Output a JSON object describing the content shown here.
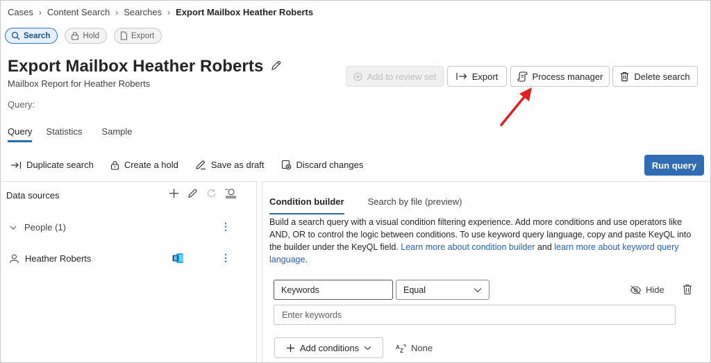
{
  "breadcrumb": [
    "Cases",
    "Content Search",
    "Searches",
    "Export Mailbox Heather Roberts"
  ],
  "pills": {
    "search": "Search",
    "hold": "Hold",
    "export": "Export"
  },
  "header": {
    "title": "Export Mailbox Heather Roberts",
    "subtitle": "Mailbox Report for Heather Roberts",
    "query_label": "Query:"
  },
  "actions": {
    "add_review": "Add to review set",
    "export": "Export",
    "process_manager": "Process manager",
    "delete": "Delete search"
  },
  "tabs": [
    "Query",
    "Statistics",
    "Sample"
  ],
  "toolbar": {
    "duplicate": "Duplicate search",
    "hold": "Create a hold",
    "draft": "Save as draft",
    "discard": "Discard changes",
    "run": "Run query"
  },
  "data_sources": {
    "title": "Data sources",
    "group": "People (1)",
    "person": "Heather Roberts"
  },
  "condition": {
    "tabs": [
      "Condition builder",
      "Search by file (preview)"
    ],
    "desc_text": "Build a search query with a visual condition filtering experience. Add more conditions and use operators like AND, OR to control the logic between conditions. To use keyword query language, copy and paste KeyQL into the builder under the KeyQL field. ",
    "link1": "Learn more about condition builder",
    "and_text": " and ",
    "link2": "learn more about keyword query language",
    "period": ".",
    "field": "Keywords",
    "operator": "Equal",
    "hide": "Hide",
    "placeholder": "Enter keywords",
    "add_conditions": "Add conditions",
    "none": "None"
  },
  "colors": {
    "accent": "#2f6cb3",
    "arrow": "#e02020"
  }
}
